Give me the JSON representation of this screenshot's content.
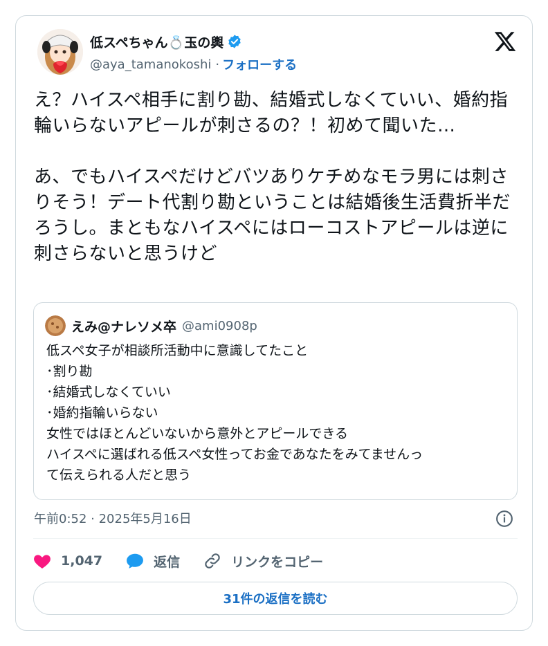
{
  "author": {
    "display_name": "低スペちゃん💍玉の輿",
    "handle": "@aya_tamanokoshi",
    "separator": "·",
    "follow_label": "フォローする",
    "avatar_icon": "anime-girl-avatar",
    "verified_icon": "verified-badge-icon"
  },
  "tweet": {
    "paragraph_1": "え？ハイスペ相手に割り勘、結婚式しなくていい、婚約指輪いらないアピールが刺さるの？！初めて聞いた…",
    "paragraph_2": "あ、でもハイスペだけどバツありケチめなモラ男には刺さりそう！デート代割り勘ということは結婚後生活費折半だろうし。まともなハイスペにはローコストアピールは逆に刺さらないと思うけど"
  },
  "quote": {
    "display_name": "えみ@ナレソメ卒",
    "handle": "@ami0908p",
    "lines": [
      "低スペ女子が相談所活動中に意識してたこと",
      "･割り勘",
      "･結婚式しなくていい",
      "･婚約指輪いらない",
      "女性ではほとんどいないから意外とアピールできる",
      "ハイスペに選ばれる低スペ女性ってお金であなたをみてませんっ",
      "て伝えられる人だと思う"
    ]
  },
  "meta": {
    "timestamp": "午前0:52 · 2025年5月16日"
  },
  "actions": {
    "likes_count": "1,047",
    "reply_label": "返信",
    "copy_link_label": "リンクをコピー"
  },
  "footer": {
    "read_replies_label": "31件の返信を読む"
  },
  "colors": {
    "link": "#1a6fc4",
    "secondary_text": "#536471",
    "border": "#cfd9de",
    "like": "#f91880",
    "verified": "#1d9bf0"
  }
}
